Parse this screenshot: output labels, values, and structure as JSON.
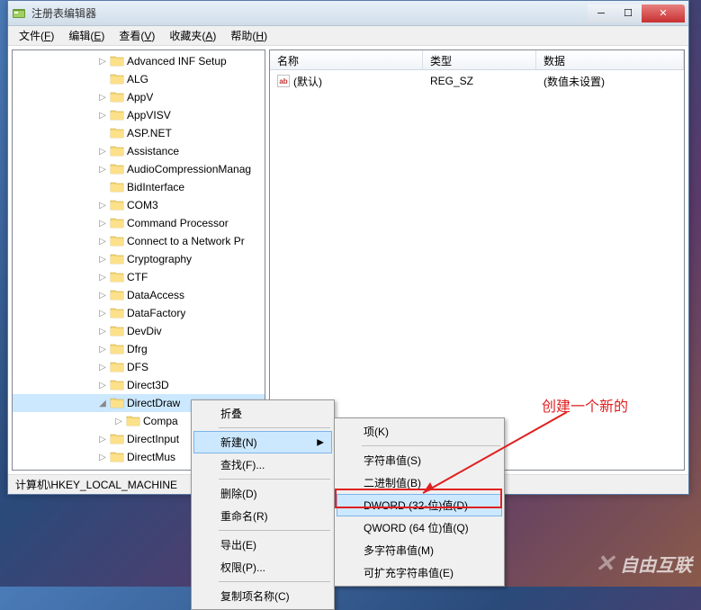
{
  "window": {
    "title": "注册表编辑器"
  },
  "menubar": {
    "items": [
      {
        "label": "文件(F)",
        "key": "F"
      },
      {
        "label": "编辑(E)",
        "key": "E"
      },
      {
        "label": "查看(V)",
        "key": "V"
      },
      {
        "label": "收藏夹(A)",
        "key": "A"
      },
      {
        "label": "帮助(H)",
        "key": "H"
      }
    ]
  },
  "tree": {
    "items": [
      {
        "indent": 92,
        "exp": "▷",
        "label": "Advanced INF Setup"
      },
      {
        "indent": 92,
        "exp": "",
        "label": "ALG"
      },
      {
        "indent": 92,
        "exp": "▷",
        "label": "AppV"
      },
      {
        "indent": 92,
        "exp": "▷",
        "label": "AppVISV"
      },
      {
        "indent": 92,
        "exp": "",
        "label": "ASP.NET"
      },
      {
        "indent": 92,
        "exp": "▷",
        "label": "Assistance"
      },
      {
        "indent": 92,
        "exp": "▷",
        "label": "AudioCompressionManag"
      },
      {
        "indent": 92,
        "exp": "",
        "label": "BidInterface"
      },
      {
        "indent": 92,
        "exp": "▷",
        "label": "COM3"
      },
      {
        "indent": 92,
        "exp": "▷",
        "label": "Command Processor"
      },
      {
        "indent": 92,
        "exp": "▷",
        "label": "Connect to a Network Pr"
      },
      {
        "indent": 92,
        "exp": "▷",
        "label": "Cryptography"
      },
      {
        "indent": 92,
        "exp": "▷",
        "label": "CTF"
      },
      {
        "indent": 92,
        "exp": "▷",
        "label": "DataAccess"
      },
      {
        "indent": 92,
        "exp": "▷",
        "label": "DataFactory"
      },
      {
        "indent": 92,
        "exp": "▷",
        "label": "DevDiv"
      },
      {
        "indent": 92,
        "exp": "▷",
        "label": "Dfrg"
      },
      {
        "indent": 92,
        "exp": "▷",
        "label": "DFS"
      },
      {
        "indent": 92,
        "exp": "▷",
        "label": "Direct3D"
      },
      {
        "indent": 92,
        "exp": "◢",
        "label": "DirectDraw",
        "selected": true
      },
      {
        "indent": 110,
        "exp": "▷",
        "label": "Compa"
      },
      {
        "indent": 92,
        "exp": "▷",
        "label": "DirectInput"
      },
      {
        "indent": 92,
        "exp": "▷",
        "label": "DirectMus"
      }
    ]
  },
  "list": {
    "columns": {
      "name": "名称",
      "type": "类型",
      "data": "数据"
    },
    "rows": [
      {
        "name": "(默认)",
        "type": "REG_SZ",
        "data": "(数值未设置)"
      }
    ]
  },
  "statusbar": {
    "path": "计算机\\HKEY_LOCAL_MACHINE"
  },
  "context_menu_1": {
    "collapse": "折叠",
    "new": "新建(N)",
    "find": "查找(F)...",
    "delete": "删除(D)",
    "rename": "重命名(R)",
    "export": "导出(E)",
    "permissions": "权限(P)...",
    "copy_key": "复制项名称(C)"
  },
  "context_menu_2": {
    "key": "项(K)",
    "string": "字符串值(S)",
    "binary": "二进制值(B)",
    "dword": "DWORD (32-位)值(D)",
    "qword": "QWORD (64 位)值(Q)",
    "multi": "多字符串值(M)",
    "expand": "可扩充字符串值(E)"
  },
  "annotation": {
    "text": "创建一个新的"
  },
  "watermark": {
    "text": "自由互联"
  }
}
